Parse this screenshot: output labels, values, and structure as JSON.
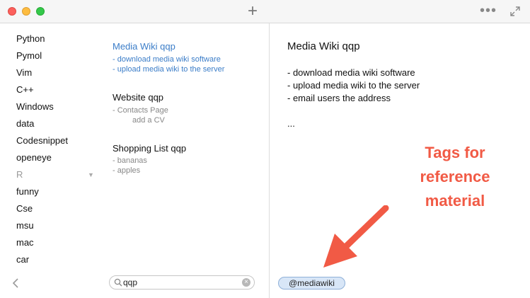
{
  "window": {
    "new_note_icon": "plus-icon",
    "more_icon": "ellipsis-icon",
    "more_label": "•••",
    "expand_icon": "expand-icon"
  },
  "sidebar": {
    "items": [
      {
        "label": "Python"
      },
      {
        "label": "Pymol"
      },
      {
        "label": "Vim"
      },
      {
        "label": "C++"
      },
      {
        "label": "Windows"
      },
      {
        "label": "data"
      },
      {
        "label": "Codesnippet"
      },
      {
        "label": "openeye"
      },
      {
        "label": "R"
      },
      {
        "label": "funny"
      },
      {
        "label": "Cse"
      },
      {
        "label": "msu"
      },
      {
        "label": "mac"
      },
      {
        "label": "car"
      }
    ],
    "caret": "▼",
    "back_icon": "chevron-left-icon"
  },
  "notes": [
    {
      "title": "Media Wiki qqp",
      "lines": [
        "- download media wiki software",
        "- upload media wiki to the server"
      ]
    },
    {
      "title": "Website qqp",
      "lines": [
        "- Contacts Page",
        "add a CV"
      ]
    },
    {
      "title": "Shopping List qqp",
      "lines": [
        "- bananas",
        "- apples"
      ]
    }
  ],
  "search": {
    "value": "qqp",
    "clear_label": "×"
  },
  "editor": {
    "title": "Media Wiki qqp",
    "lines": [
      "- download media wiki software",
      "- upload media wiki to the server",
      "- email users the address",
      "..."
    ],
    "tag": "@mediawiki"
  },
  "annotation": {
    "text_lines": [
      "Tags for",
      "reference",
      "material"
    ],
    "color": "#f15a45"
  },
  "colors": {
    "accent": "#3b7dc8",
    "annotation": "#f15a45"
  }
}
